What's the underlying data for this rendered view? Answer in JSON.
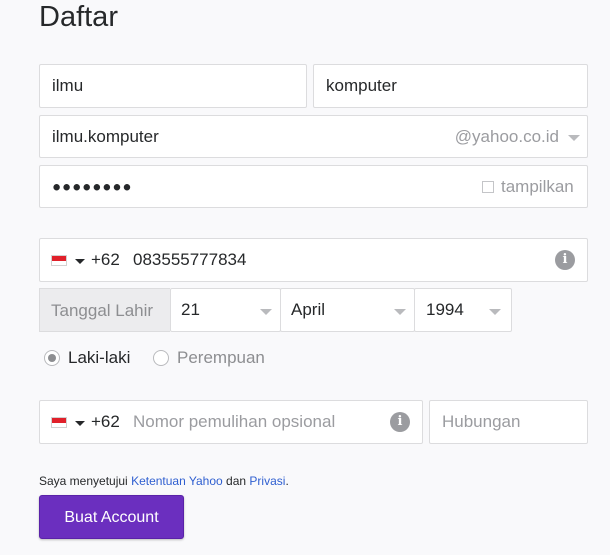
{
  "title": "Daftar",
  "first_name": {
    "value": "ilmu"
  },
  "last_name": {
    "value": "komputer"
  },
  "username": {
    "value": "ilmu.komputer",
    "domain": "@yahoo.co.id"
  },
  "password": {
    "value": "●●●●●●●●",
    "show_label": "tampilkan"
  },
  "phone": {
    "country_code": "+62",
    "number": "083555777834",
    "flag": "indonesia-flag"
  },
  "birthdate": {
    "label": "Tanggal Lahir",
    "day": "21",
    "month": "April",
    "year": "1994"
  },
  "gender": {
    "male_label": "Laki-laki",
    "female_label": "Perempuan",
    "selected": "Laki-laki"
  },
  "recovery": {
    "country_code": "+62",
    "placeholder": "Nomor pemulihan opsional",
    "relation_placeholder": "Hubungan"
  },
  "terms": {
    "prefix": "Saya menyetujui",
    "terms_link": "Ketentuan Yahoo",
    "and": "dan",
    "privacy_link": "Privasi",
    "suffix": "."
  },
  "submit": {
    "label": "Buat Account"
  },
  "colors": {
    "accent": "#6b2fbf",
    "link": "#2f5fd0",
    "background": "#f9f9fb"
  }
}
